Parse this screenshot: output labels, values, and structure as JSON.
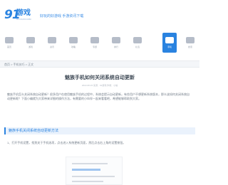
{
  "header": {
    "logo_mark": "91",
    "logo_text": "游戏",
    "logo_sub": "91YOUXI.COM",
    "slogan": "好玩的好游戏  手游资讯下载"
  },
  "nav": {
    "items": [
      {
        "label": "首页",
        "icon": "home-icon"
      },
      {
        "label": "游戏",
        "icon": "gamepad-icon"
      },
      {
        "label": "资讯",
        "icon": "news-icon"
      },
      {
        "label": "攻略",
        "icon": "guide-icon"
      },
      {
        "label": "专题",
        "icon": "topic-icon"
      },
      {
        "label": "排行",
        "icon": "rank-icon"
      },
      {
        "label": "礼包",
        "icon": "gift-icon"
      },
      {
        "label": "手机",
        "icon": "phone-icon",
        "active": true
      },
      {
        "label": "搜索",
        "icon": "search-icon"
      }
    ],
    "accent": "#2a83e0"
  },
  "breadcrumb": "首页 > 手机技巧 > 正文",
  "article": {
    "title": "魅族手机如何关闭系统自动更新",
    "meta": "2022-08-15  来源：91游戏  作者：小编",
    "para1": "魅族手机怎么关闭系统自动更新？很多用户在使用魅族手机的过程中，系统会提示自动更新，有些用户不想更新系统版本，那么该如何关闭系统自动更新呢？下面小编就为大家带来详细的操作方法，有需要的小伙伴一起来看看吧，希望能够帮助到大家。",
    "section": "魅族手机关闭系统自动更新方法",
    "para2": "1、打开手机设置，找到关于手机选项，点击进入系统更新页面，然后点击右上角的设置按钮。"
  }
}
